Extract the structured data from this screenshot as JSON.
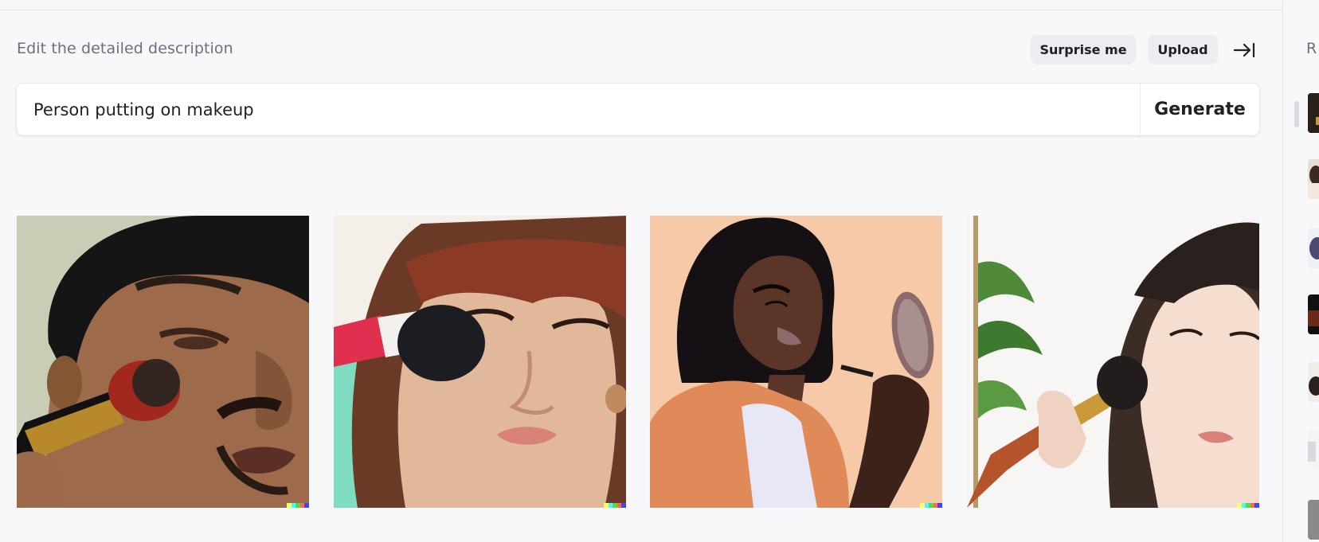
{
  "header": {
    "edit_label": "Edit the detailed description",
    "surprise_label": "Surprise me",
    "upload_label": "Upload"
  },
  "prompt": {
    "value": "Person putting on makeup",
    "generate_label": "Generate"
  },
  "results": [
    {
      "alt": "Close-up of a man applying makeup with a brush"
    },
    {
      "alt": "Woman with bangs applying blush with a brush"
    },
    {
      "alt": "Illustration of a woman holding a mirror and a brush"
    },
    {
      "alt": "Young woman applying powder with a brush near a plant"
    }
  ],
  "sidebar": {
    "title": "R"
  },
  "colors": {
    "background": "#f8f8fa",
    "pill": "#ececf1",
    "signature": [
      "#ffff66",
      "#42ffff",
      "#51da4c",
      "#ff6e3c",
      "#3c46ff"
    ]
  }
}
